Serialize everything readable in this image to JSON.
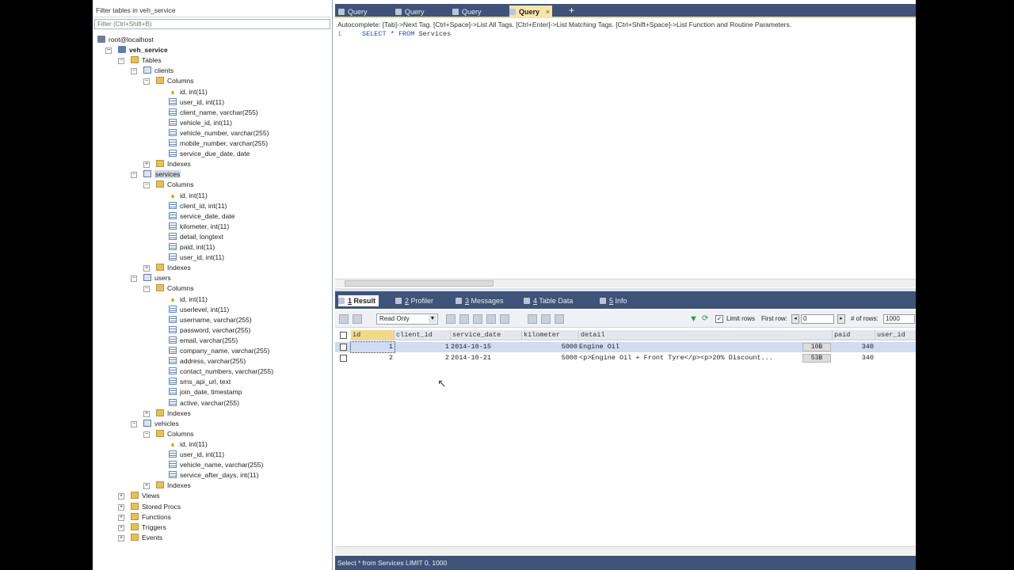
{
  "left": {
    "filter_label": "Filter tables in veh_service",
    "filter_placeholder": "Filter (Ctrl+Shift+B)",
    "tree": [
      {
        "label": "root@localhost",
        "level": 0,
        "icon": "server",
        "exp": ""
      },
      {
        "label": "veh_service",
        "level": 1,
        "icon": "db",
        "exp": "−",
        "bold": true
      },
      {
        "label": "Tables",
        "level": 2,
        "icon": "folder",
        "exp": "−"
      },
      {
        "label": "clients",
        "level": 3,
        "icon": "table",
        "exp": "−"
      },
      {
        "label": "Columns",
        "level": 4,
        "icon": "folder",
        "exp": "−"
      },
      {
        "label": "id, int(11)",
        "level": 5,
        "icon": "key"
      },
      {
        "label": "user_id, int(11)",
        "level": 5,
        "icon": "col"
      },
      {
        "label": "client_name, varchar(255)",
        "level": 5,
        "icon": "col"
      },
      {
        "label": "vehicle_id, int(11)",
        "level": 5,
        "icon": "col"
      },
      {
        "label": "vehicle_number, varchar(255)",
        "level": 5,
        "icon": "col"
      },
      {
        "label": "mobile_number, varchar(255)",
        "level": 5,
        "icon": "col"
      },
      {
        "label": "service_due_date, date",
        "level": 5,
        "icon": "col"
      },
      {
        "label": "Indexes",
        "level": 4,
        "icon": "folder",
        "exp": "+"
      },
      {
        "label": "services",
        "level": 3,
        "icon": "table",
        "exp": "−",
        "sel": true
      },
      {
        "label": "Columns",
        "level": 4,
        "icon": "folder",
        "exp": "−"
      },
      {
        "label": "id, int(11)",
        "level": 5,
        "icon": "key"
      },
      {
        "label": "client_id, int(11)",
        "level": 5,
        "icon": "col"
      },
      {
        "label": "service_date, date",
        "level": 5,
        "icon": "col"
      },
      {
        "label": "kilometer, int(11)",
        "level": 5,
        "icon": "col"
      },
      {
        "label": "detail, longtext",
        "level": 5,
        "icon": "col"
      },
      {
        "label": "paid, int(11)",
        "level": 5,
        "icon": "col"
      },
      {
        "label": "user_id, int(11)",
        "level": 5,
        "icon": "col"
      },
      {
        "label": "Indexes",
        "level": 4,
        "icon": "folder",
        "exp": "+"
      },
      {
        "label": "users",
        "level": 3,
        "icon": "table",
        "exp": "−"
      },
      {
        "label": "Columns",
        "level": 4,
        "icon": "folder",
        "exp": "−"
      },
      {
        "label": "id, int(11)",
        "level": 5,
        "icon": "key"
      },
      {
        "label": "userlevel, int(11)",
        "level": 5,
        "icon": "col"
      },
      {
        "label": "username, varchar(255)",
        "level": 5,
        "icon": "col"
      },
      {
        "label": "password, varchar(255)",
        "level": 5,
        "icon": "col"
      },
      {
        "label": "email, varchar(255)",
        "level": 5,
        "icon": "col"
      },
      {
        "label": "company_name, varchar(255)",
        "level": 5,
        "icon": "col"
      },
      {
        "label": "address, varchar(255)",
        "level": 5,
        "icon": "col"
      },
      {
        "label": "contact_numbers, varchar(255)",
        "level": 5,
        "icon": "col"
      },
      {
        "label": "sms_api_url, text",
        "level": 5,
        "icon": "col"
      },
      {
        "label": "join_date, timestamp",
        "level": 5,
        "icon": "col"
      },
      {
        "label": "active, varchar(255)",
        "level": 5,
        "icon": "col"
      },
      {
        "label": "Indexes",
        "level": 4,
        "icon": "folder",
        "exp": "+"
      },
      {
        "label": "vehicles",
        "level": 3,
        "icon": "table",
        "exp": "−"
      },
      {
        "label": "Columns",
        "level": 4,
        "icon": "folder",
        "exp": "−"
      },
      {
        "label": "id, int(11)",
        "level": 5,
        "icon": "key"
      },
      {
        "label": "user_id, int(11)",
        "level": 5,
        "icon": "col"
      },
      {
        "label": "vehicle_name, varchar(255)",
        "level": 5,
        "icon": "col"
      },
      {
        "label": "service_after_days, int(11)",
        "level": 5,
        "icon": "col"
      },
      {
        "label": "Indexes",
        "level": 4,
        "icon": "folder",
        "exp": "+"
      },
      {
        "label": "Views",
        "level": 2,
        "icon": "folder",
        "exp": "+"
      },
      {
        "label": "Stored Procs",
        "level": 2,
        "icon": "folder",
        "exp": "+"
      },
      {
        "label": "Functions",
        "level": 2,
        "icon": "folder",
        "exp": "+"
      },
      {
        "label": "Triggers",
        "level": 2,
        "icon": "folder",
        "exp": "+"
      },
      {
        "label": "Events",
        "level": 2,
        "icon": "folder",
        "exp": "+"
      }
    ]
  },
  "tabs": [
    "Query",
    "Query",
    "Query",
    "Query"
  ],
  "active_tab_index": 3,
  "add_tab": "+",
  "autocomplete": "Autocomplete: [Tab]->Next Tag. [Ctrl+Space]->List All Tags. [Ctrl+Enter]->List Matching Tags. [Ctrl+Shift+Space]->List Function and Routine Parameters.",
  "editor": {
    "line_number": "1",
    "kw1": "SELECT",
    "star": "*",
    "kw2": "FROM",
    "table": "Services"
  },
  "result_tabs": [
    {
      "num": "1",
      "label": "Result",
      "active": true
    },
    {
      "num": "2",
      "label": "Profiler"
    },
    {
      "num": "3",
      "label": "Messages"
    },
    {
      "num": "4",
      "label": "Table Data"
    },
    {
      "num": "5",
      "label": "Info"
    }
  ],
  "toolbar": {
    "mode_value": "Read Only",
    "limit_rows_label": "Limit rows",
    "first_row_label": "First row:",
    "first_row_value": "0",
    "rows_label": "# of rows:",
    "rows_value": "1000",
    "prev": "◂",
    "next": "▸",
    "limit_checked": "✓"
  },
  "grid": {
    "columns": [
      "id",
      "client_id",
      "service_date",
      "kilometer",
      "detail",
      "paid",
      "user_id"
    ],
    "rows": [
      {
        "id": "1",
        "client_id": "1",
        "service_date": "2014-10-15",
        "kilometer": "5000",
        "detail": "Engine Oil",
        "blob": "10B",
        "paid": "340",
        "user_id": ""
      },
      {
        "id": "2",
        "client_id": "2",
        "service_date": "2014-10-21",
        "kilometer": "5000",
        "detail": "<p>Engine Oil + Front Tyre</p><p>20% Discount...",
        "blob": "53B",
        "paid": "340",
        "user_id": ""
      }
    ]
  },
  "status": "Select * from Services LIMIT 0, 1000"
}
